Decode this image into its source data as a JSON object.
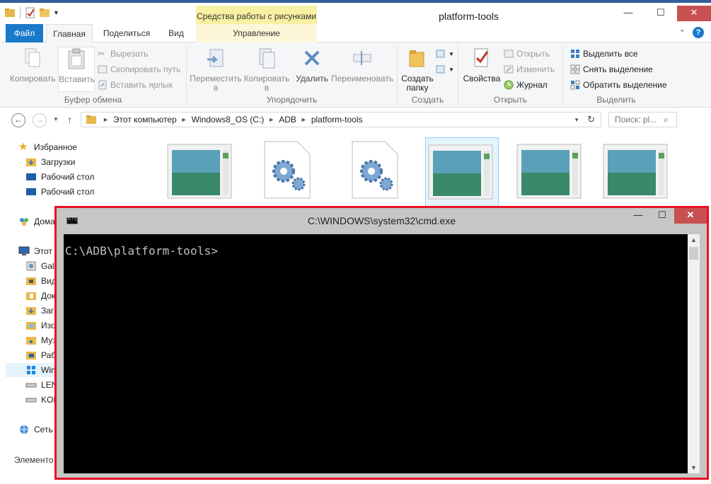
{
  "explorer": {
    "title": "platform-tools",
    "context_tools_label": "Средства работы с рисунками",
    "tabs": {
      "file": "Файл",
      "home": "Главная",
      "share": "Поделиться",
      "view": "Вид",
      "manage": "Управление"
    },
    "ribbon": {
      "clipboard": {
        "label": "Буфер обмена",
        "copy": "Копировать",
        "paste": "Вставить",
        "cut": "Вырезать",
        "copy_path": "Скопировать путь",
        "paste_shortcut": "Вставить ярлык"
      },
      "organize": {
        "label": "Упорядочить",
        "move_to": "Переместить в",
        "copy_to": "Копировать в",
        "delete": "Удалить",
        "rename": "Переименовать"
      },
      "new": {
        "label": "Создать",
        "new_folder": "Создать папку"
      },
      "open": {
        "label": "Открыть",
        "properties": "Свойства",
        "open": "Открыть",
        "edit": "Изменить",
        "history": "Журнал"
      },
      "select": {
        "label": "Выделить",
        "select_all": "Выделить все",
        "select_none": "Снять выделение",
        "invert": "Обратить выделение"
      }
    },
    "address": {
      "crumbs": [
        "Этот компьютер",
        "Windows8_OS (C:)",
        "ADB",
        "platform-tools"
      ],
      "search_placeholder": "Поиск: pl..."
    },
    "nav": {
      "favorites": "Избранное",
      "downloads": "Загрузки",
      "desktop1": "Рабочий стол",
      "desktop2": "Рабочий стол",
      "homegroup": "Дома",
      "thispc": "Этот",
      "gal": "Gal",
      "videos": "Вид",
      "documents": "Док",
      "downloads2": "Заг",
      "images": "Изо",
      "music": "Муз",
      "desktop3": "Раб",
      "windows": "Win",
      "len": "LEN",
      "kod": "KOD",
      "network": "Сеть"
    },
    "status": "Элементо"
  },
  "cmd": {
    "title": "C:\\WINDOWS\\system32\\cmd.exe",
    "icon_text": "C:\\.",
    "prompt": "C:\\ADB\\platform-tools>"
  },
  "colors": {
    "file_tab": "#1979ca",
    "context_tools": "#f8f0a2",
    "highlight_border": "#e81123",
    "close_button": "#c75050",
    "console_bg": "#000000",
    "console_text": "#c0c0c0"
  }
}
